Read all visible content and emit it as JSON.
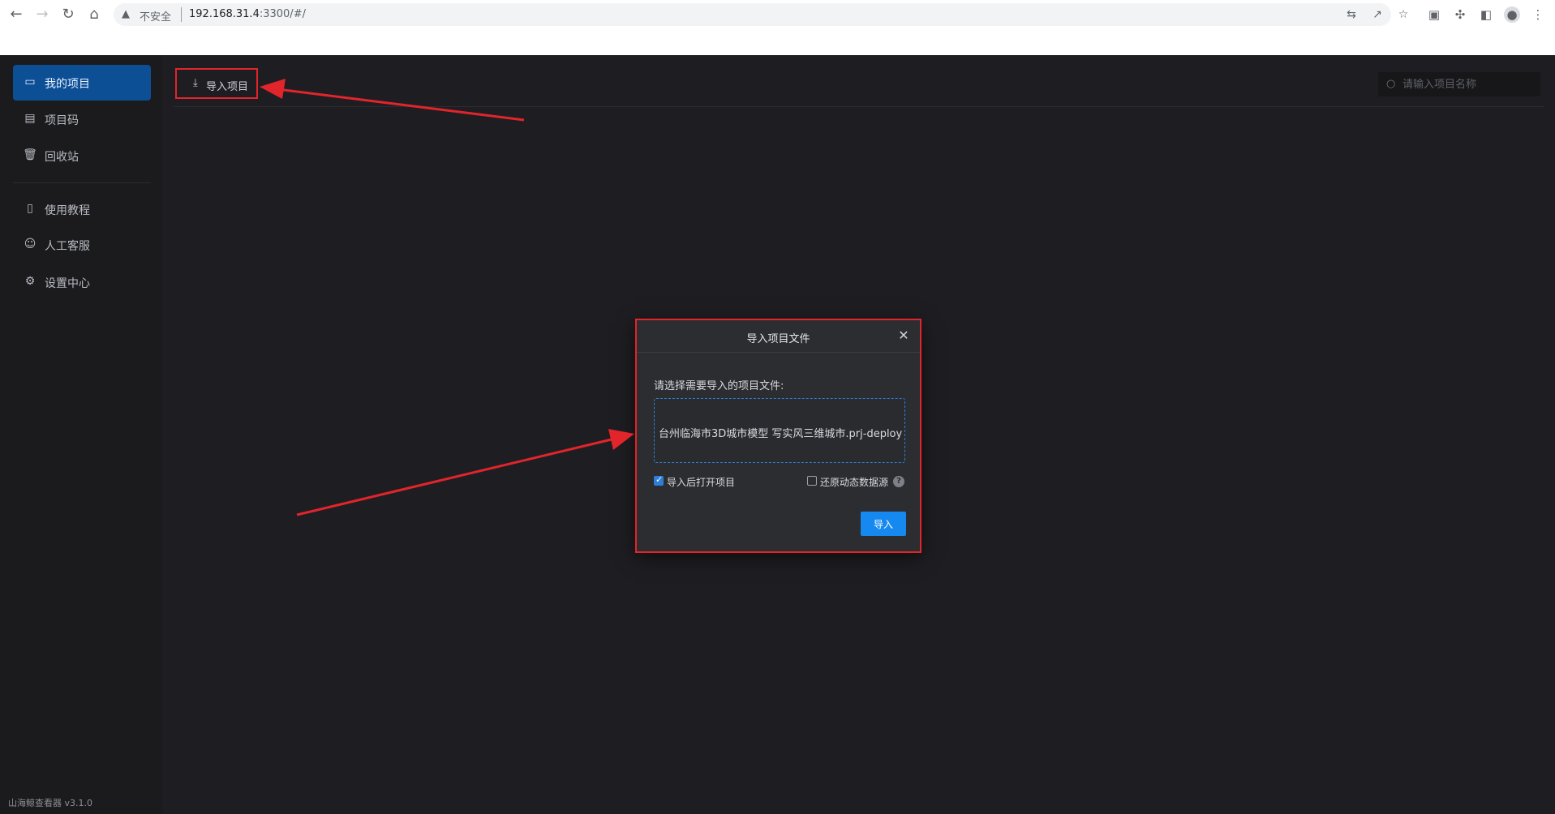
{
  "browser": {
    "insecure_label": "不安全",
    "url_host": "192.168.31.4",
    "url_path": ":3300/#/"
  },
  "sidebar": {
    "items": [
      {
        "label": "我的项目",
        "icon": "monitor-icon",
        "active": true
      },
      {
        "label": "项目码",
        "icon": "document-icon",
        "active": false
      },
      {
        "label": "回收站",
        "icon": "trash-icon",
        "active": false
      },
      {
        "label": "使用教程",
        "icon": "book-icon",
        "active": false
      },
      {
        "label": "人工客服",
        "icon": "user-icon",
        "active": false
      },
      {
        "label": "设置中心",
        "icon": "gear-icon",
        "active": false
      }
    ],
    "version": "山海鲸查看器 v3.1.0"
  },
  "toolbar": {
    "import_label": "导入项目",
    "search_placeholder": "请输入项目名称"
  },
  "modal": {
    "title": "导入项目文件",
    "prompt": "请选择需要导入的项目文件:",
    "file_name": "台州临海市3D城市模型 写实风三维城市.prj-deploy",
    "open_after_import": {
      "label": "导入后打开项目",
      "checked": true
    },
    "restore_dynamic": {
      "label": "还原动态数据源",
      "checked": false
    },
    "submit_label": "导入"
  },
  "colors": {
    "accent": "#1689f0",
    "active_nav": "#0c4f95",
    "annotation_red": "#e2242b"
  }
}
